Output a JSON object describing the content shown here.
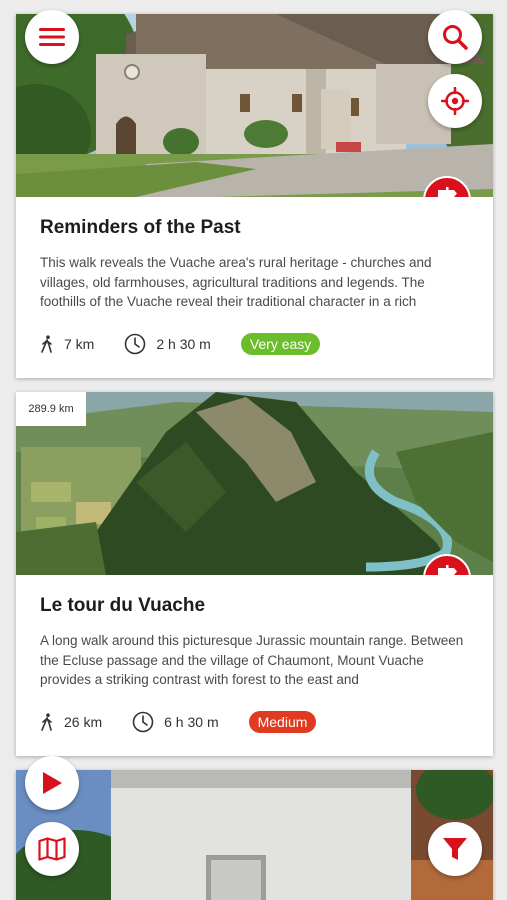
{
  "colors": {
    "accent": "#d8111c",
    "easy": "#6bbd2b",
    "medium": "#e03a1f"
  },
  "cards": [
    {
      "title": "Reminders of the Past",
      "description": "This walk reveals the Vuache area's rural heritage - churches and villages, old farmhouses, agricultural traditions and legends. The foothills of the Vuache reveal their traditional character in a rich",
      "distance": "7 km",
      "duration": "2 h 30 m",
      "difficulty": "Very easy"
    },
    {
      "distance_from_here": "289.9 km",
      "title": "Le tour du Vuache",
      "description": "A long walk around this picturesque Jurassic mountain range. Between the Ecluse passage and the village of Chaumont, Mount Vuache provides a striking contrast with forest to the east and",
      "distance": "26 km",
      "duration": "6 h 30 m",
      "difficulty": "Medium"
    }
  ],
  "fabs": [
    "menu-icon",
    "search-icon",
    "locate-icon",
    "play-icon",
    "map-icon",
    "filter-icon"
  ]
}
